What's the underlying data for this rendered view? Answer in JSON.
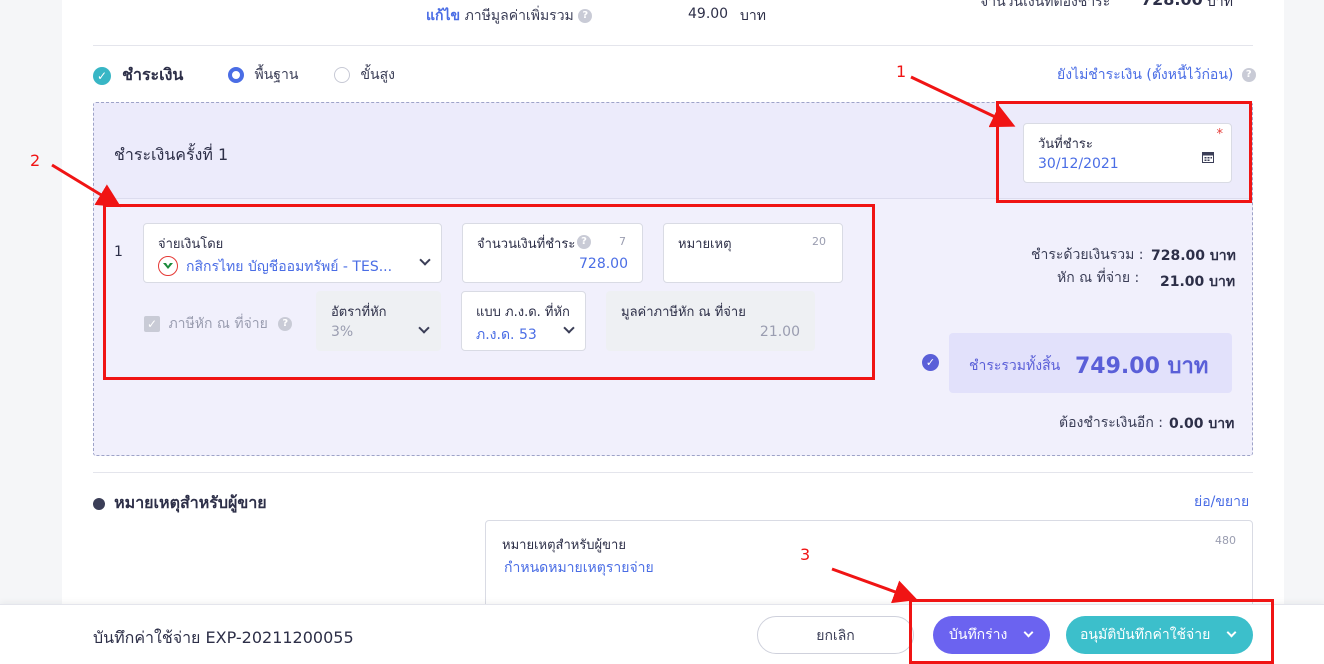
{
  "top": {
    "edit_link": "แก้ไข",
    "vat_label": "ภาษีมูลค่าเพิ่มรวม",
    "vat_value": "49.00",
    "vat_unit": "บาท",
    "cut_right_label": "จำนวนเงินที่ต้องชำระ",
    "cut_right_value": "728.00",
    "cut_right_unit": "บาท"
  },
  "payment": {
    "section_label": "ชำระเงิน",
    "mode_basic": "พื้นฐาน",
    "mode_advanced": "ขั้นสูง",
    "unpaid_link": "ยังไม่ชำระเงิน (ตั้งหนี้ไว้ก่อน)",
    "installment_title": "ชำระเงินครั้งที่ 1",
    "date_label": "วันที่ชำระ",
    "date_value": "30/12/2021",
    "required_mark": "*",
    "row_number": "1",
    "pay_by_label": "จ่ายเงินโดย",
    "pay_by_value": "กสิกรไทย บัญชีออมทรัพย์ - TES...",
    "amount_label": "จำนวนเงินที่ชำระ",
    "amount_counter": "7",
    "amount_value": "728.00",
    "note_label": "หมายเหตุ",
    "note_counter": "20",
    "wht_checkbox_label": "ภาษีหัก ณ ที่จ่าย",
    "rate_label": "อัตราที่หัก",
    "rate_value": "3%",
    "form_label": "แบบ ภ.ง.ด. ที่หัก",
    "form_value": "ภ.ง.ด. 53",
    "wht_amount_label": "มูลค่าภาษีหัก ณ ที่จ่าย",
    "wht_amount_value": "21.00",
    "sum_paid_label": "ชำระด้วยเงินรวม :",
    "sum_paid_value": "728.00 บาท",
    "wht_label": "หัก ณ ที่จ่าย :",
    "wht_value": "21.00 บาท",
    "total_label": "ชำระรวมทั้งสิ้น",
    "total_value": "749.00 บาท",
    "remaining_label": "ต้องชำระเงินอีก :",
    "remaining_value": "0.00 บาท"
  },
  "seller_note": {
    "title": "หมายเหตุสำหรับผู้ขาย",
    "toggle": "ย่อ/ขยาย",
    "field_label": "หมายเหตุสำหรับผู้ขาย",
    "counter": "480",
    "placeholder": "กำหนดหมายเหตุรายจ่าย"
  },
  "footer": {
    "doc_title": "บันทึกค่าใช้จ่าย EXP-20211200055",
    "cancel": "ยกเลิก",
    "save_draft": "บันทึกร่าง",
    "approve": "อนุมัติบันทึกค่าใช้จ่าย"
  },
  "annotations": {
    "one": "1",
    "two": "2",
    "three": "3"
  },
  "colors": {
    "accent": "#4a6de5",
    "draft_button": "#6b63f0",
    "approve_button": "#3cbfcb",
    "annotation_red": "#f01414"
  }
}
